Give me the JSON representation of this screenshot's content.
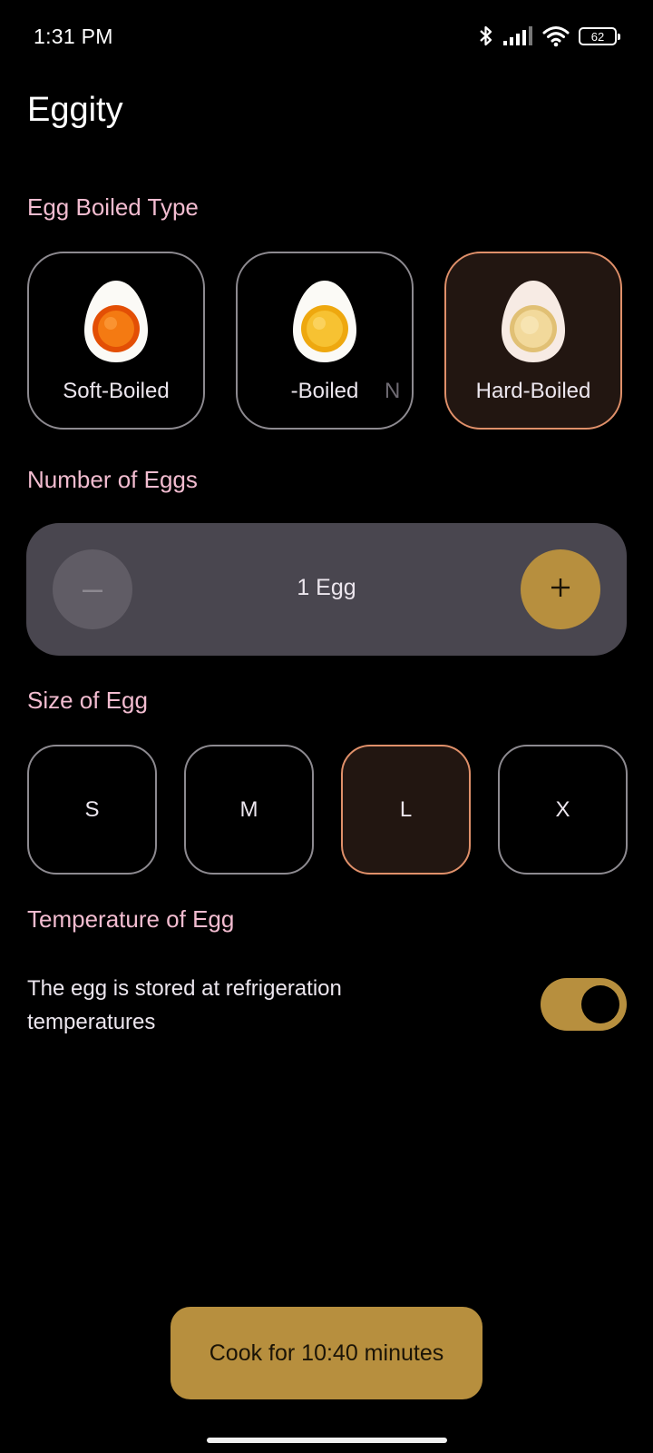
{
  "status_bar": {
    "time": "1:31 PM",
    "battery": "62",
    "icons": [
      "bluetooth-icon",
      "signal-icon",
      "wifi-icon",
      "battery-icon"
    ]
  },
  "app": {
    "title": "Eggity"
  },
  "boiled_type": {
    "heading": "Egg Boiled Type",
    "options": [
      {
        "label": "Soft-Boiled",
        "yolk": "#f06a08",
        "selected": false
      },
      {
        "label": "-Boiled",
        "trailing": "N",
        "yolk": "#f5b51e",
        "selected": false
      },
      {
        "label": "Hard-Boiled",
        "yolk": "#f1d58f",
        "selected": true
      }
    ]
  },
  "egg_count": {
    "heading": "Number of Eggs",
    "value": "1 Egg",
    "minus_icon": "minus-icon",
    "plus_icon": "plus-icon"
  },
  "egg_size": {
    "heading": "Size of Egg",
    "options": [
      {
        "label": "S",
        "selected": false
      },
      {
        "label": "M",
        "selected": false
      },
      {
        "label": "L",
        "selected": true
      },
      {
        "label": "X",
        "selected": false
      }
    ]
  },
  "temperature": {
    "heading": "Temperature of Egg",
    "description": "The egg is stored at refrigeration temperatures",
    "toggle_on": true
  },
  "cook_button": {
    "label": "Cook for 10:40 minutes"
  },
  "colors": {
    "accent": "#b78f3e",
    "heading": "#f2bcd0",
    "selected_border": "#e0906a",
    "selected_bg": "#221611",
    "stepper_bg": "#49464f"
  }
}
